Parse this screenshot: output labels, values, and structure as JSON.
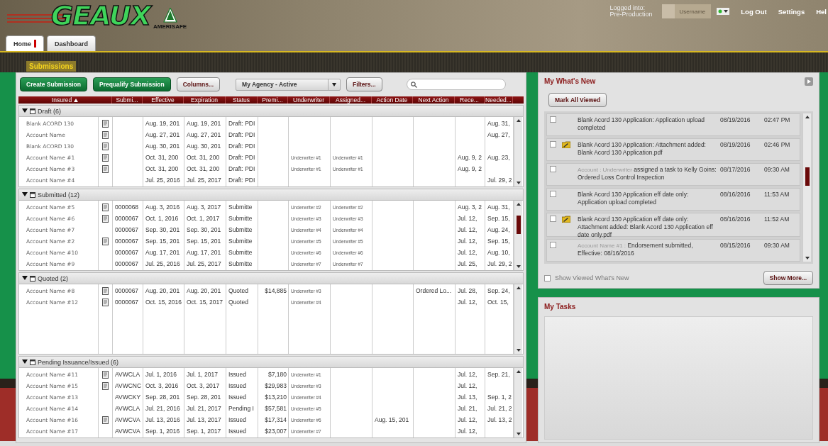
{
  "header": {
    "logo": "GEAUX",
    "logo_sub": "AMERISAFE",
    "login_label": "Logged into:",
    "environment": "Pre-Production",
    "username": "Username",
    "links": [
      "Log Out",
      "Settings",
      "Hel"
    ]
  },
  "tabs": [
    {
      "label": "Home",
      "selected": true
    },
    {
      "label": "Dashboard",
      "selected": false
    }
  ],
  "section_title": "Submissions",
  "toolbar": {
    "buttons": [
      {
        "label": "Create Submission",
        "kind": "primary"
      },
      {
        "label": "Prequalify Submission",
        "kind": "primary"
      },
      {
        "label": "Columns...",
        "kind": "secondary"
      }
    ],
    "filter_value": "My Agency - Active",
    "filters_button": "Filters..."
  },
  "table": {
    "columns": [
      {
        "label": "Insured",
        "sorted": true
      },
      {
        "label": "Submi...",
        "sorted": false
      },
      {
        "label": "Effective",
        "sorted": false
      },
      {
        "label": "Expiration",
        "sorted": false
      },
      {
        "label": "Status",
        "sorted": false
      },
      {
        "label": "Premi...",
        "sorted": false
      },
      {
        "label": "Underwriter",
        "sorted": false
      },
      {
        "label": "Assigned...",
        "sorted": false
      },
      {
        "label": "Action Date",
        "sorted": false
      },
      {
        "label": "Next Action",
        "sorted": false
      },
      {
        "label": "Rece...",
        "sorted": false
      },
      {
        "label": "Needed...",
        "sorted": false
      }
    ],
    "groups": [
      {
        "label": "Draft (6)",
        "expanded": true,
        "rows": [
          {
            "insured": "Blank ACORD 130",
            "doc": true,
            "effective": "Aug. 19, 201",
            "expiration": "Aug. 19, 201",
            "status": "Draft: PDI",
            "needed": "Aug. 31,"
          },
          {
            "insured": "Account Name",
            "doc": true,
            "effective": "Aug. 27, 201",
            "expiration": "Aug. 27, 201",
            "status": "Draft: PDI",
            "needed": "Aug. 27,"
          },
          {
            "insured": "Blank ACORD 130",
            "doc": true,
            "effective": "Aug. 30, 201",
            "expiration": "Aug. 30, 201",
            "status": "Draft: PDI"
          },
          {
            "insured": "Account Name #1",
            "doc": true,
            "effective": "Oct. 31, 200",
            "expiration": "Oct. 31, 200",
            "status": "Draft: PDI",
            "underwriter": "Underwriter #1",
            "assigned": "Underwriter #1",
            "rece": "Aug. 9, 2",
            "needed": "Aug. 23,"
          },
          {
            "insured": "Account Name #3",
            "doc": true,
            "effective": "Oct. 31, 200",
            "expiration": "Oct. 31, 200",
            "status": "Draft: PDI",
            "underwriter": "Underwriter #1",
            "assigned": "Underwriter #1",
            "rece": "Aug. 9, 2"
          },
          {
            "insured": "Account Name #4",
            "doc": false,
            "effective": "Jul. 25, 2016",
            "expiration": "Jul. 25, 2017",
            "status": "Draft: PDI",
            "needed": "Jul. 29, 2"
          }
        ]
      },
      {
        "label": "Submitted (12)",
        "expanded": true,
        "rows": [
          {
            "insured": "Account Name #5",
            "doc": true,
            "submi": "0000068",
            "effective": "Aug. 3, 2016",
            "expiration": "Aug. 3, 2017",
            "status": "Submitte",
            "underwriter": "Underwriter #2",
            "assigned": "Underwriter #2",
            "rece": "Aug. 3, 2",
            "needed": "Aug. 31,"
          },
          {
            "insured": "Account Name #6",
            "doc": true,
            "submi": "0000067",
            "effective": "Oct. 1, 2016",
            "expiration": "Oct. 1, 2017",
            "status": "Submitte",
            "underwriter": "Underwriter #3",
            "assigned": "Underwriter #3",
            "rece": "Jul. 12,",
            "needed": "Sep. 15,"
          },
          {
            "insured": "Account Name #7",
            "doc": false,
            "submi": "0000067",
            "effective": "Sep. 30, 201",
            "expiration": "Sep. 30, 201",
            "status": "Submitte",
            "underwriter": "Underwriter #4",
            "assigned": "Underwriter #4",
            "rece": "Jul. 12,",
            "needed": "Aug. 24,"
          },
          {
            "insured": "Account Name #2",
            "doc": true,
            "submi": "0000067",
            "effective": "Sep. 15, 201",
            "expiration": "Sep. 15, 201",
            "status": "Submitte",
            "underwriter": "Underwriter #5",
            "assigned": "Underwriter #5",
            "rece": "Jul. 12,",
            "needed": "Sep. 15,"
          },
          {
            "insured": "Account Name #10",
            "doc": false,
            "submi": "0000067",
            "effective": "Aug. 17, 201",
            "expiration": "Aug. 17, 201",
            "status": "Submitte",
            "underwriter": "Underwriter #6",
            "assigned": "Underwriter #6",
            "rece": "Jul. 12,",
            "needed": "Aug. 10,"
          },
          {
            "insured": "Account Name #9",
            "doc": false,
            "submi": "0000067",
            "effective": "Jul. 25, 2016",
            "expiration": "Jul. 25, 2017",
            "status": "Submitte",
            "underwriter": "Underwriter #7",
            "assigned": "Underwriter #7",
            "rece": "Jul. 25,",
            "needed": "Jul. 29, 2"
          }
        ]
      },
      {
        "label": "Quoted (2)",
        "expanded": true,
        "rows": [
          {
            "insured": "Account Name #8",
            "doc": true,
            "submi": "0000067",
            "effective": "Aug. 20, 201",
            "expiration": "Aug. 20, 201",
            "status": "Quoted",
            "premi": "$14,885",
            "underwriter": "Underwriter #3",
            "next_action": "Ordered Lo...",
            "rece": "Jul. 28,",
            "needed": "Sep. 24,"
          },
          {
            "insured": "Account Name #12",
            "doc": true,
            "submi": "0000067",
            "effective": "Oct. 15, 2016",
            "expiration": "Oct. 15, 2017",
            "status": "Quoted",
            "underwriter": "Underwriter #4",
            "rece": "Jul. 12,",
            "needed": "Oct. 15,"
          }
        ]
      },
      {
        "label": "Pending Issuance/Issued (6)",
        "expanded": true,
        "rows": [
          {
            "insured": "Account Name #11",
            "doc": true,
            "submi": "AVWCLA",
            "effective": "Jul. 1, 2016",
            "expiration": "Jul. 1, 2017",
            "status": "Issued",
            "premi": "$7,180",
            "underwriter": "Underwriter #1",
            "rece": "Jul. 12,",
            "needed": "Sep. 21,"
          },
          {
            "insured": "Account Name #15",
            "doc": true,
            "submi": "AVWCNC",
            "effective": "Oct. 3, 2016",
            "expiration": "Oct. 3, 2017",
            "status": "Issued",
            "premi": "$29,983",
            "underwriter": "Underwriter #3",
            "rece": "Jul. 12,"
          },
          {
            "insured": "Account Name #13",
            "doc": false,
            "submi": "AVWCKY",
            "effective": "Sep. 28, 201",
            "expiration": "Sep. 28, 201",
            "status": "Issued",
            "premi": "$13,210",
            "underwriter": "Underwriter #4",
            "rece": "Jul. 13,",
            "needed": "Sep. 1, 2"
          },
          {
            "insured": "Account Name #14",
            "doc": false,
            "submi": "AVWCLA",
            "effective": "Jul. 21, 2016",
            "expiration": "Jul. 21, 2017",
            "status": "Pending I",
            "premi": "$57,581",
            "underwriter": "Underwriter #5",
            "rece": "Jul. 21,",
            "needed": "Jul. 21, 2"
          },
          {
            "insured": "Account Name #16",
            "doc": true,
            "submi": "AVWCVA",
            "effective": "Jul. 13, 2016",
            "expiration": "Jul. 13, 2017",
            "status": "Issued",
            "premi": "$17,314",
            "underwriter": "Underwriter #6",
            "action_date": "Aug. 15, 201",
            "rece": "Jul. 12,",
            "needed": "Jul. 13, 2"
          },
          {
            "insured": "Account Name #17",
            "doc": false,
            "submi": "AVWCVA",
            "effective": "Sep. 1, 2016",
            "expiration": "Sep. 1, 2017",
            "status": "Issued",
            "premi": "$23,007",
            "underwriter": "Underwriter #7",
            "rece": "Jul. 12,"
          }
        ]
      }
    ]
  },
  "whats_new": {
    "title": "My What's New",
    "mark_button": "Mark All Viewed",
    "items": [
      {
        "checked": false,
        "attachment": false,
        "text": "Blank Acord 130 Application:  Application upload completed",
        "date": "08/19/2016",
        "time": "02:47 PM"
      },
      {
        "checked": false,
        "attachment": true,
        "text": "Blank Acord 130 Application: Attachment added: Blank Acord 130 Application.pdf",
        "date": "08/19/2016",
        "time": "02:46 PM"
      },
      {
        "checked": false,
        "attachment": false,
        "prefix": "Account  :  Underwriter",
        "text": "assigned a task to Kelly Goins: Ordered Loss Control Inspection",
        "date": "08/17/2016",
        "time": "09:30 AM"
      },
      {
        "checked": false,
        "attachment": false,
        "text": "Blank Acord 130 Application eff date only:  Application upload completed",
        "date": "08/16/2016",
        "time": "11:53 AM"
      },
      {
        "checked": false,
        "attachment": true,
        "text": "Blank Acord 130 Application eff date only: Attachment added: Blank Acord 130 Application eff date only.pdf",
        "date": "08/16/2016",
        "time": "11:52 AM"
      },
      {
        "checked": false,
        "attachment": false,
        "prefix": "Account Name #1 :",
        "text": "Endorsement submitted, Effective: 08/16/2016",
        "date": "08/15/2016",
        "time": "09:30 AM"
      }
    ],
    "show_viewed": {
      "label": "Show Viewed What's New",
      "checked": false
    },
    "more_button": "Show More..."
  },
  "tasks": {
    "title": "My Tasks"
  }
}
